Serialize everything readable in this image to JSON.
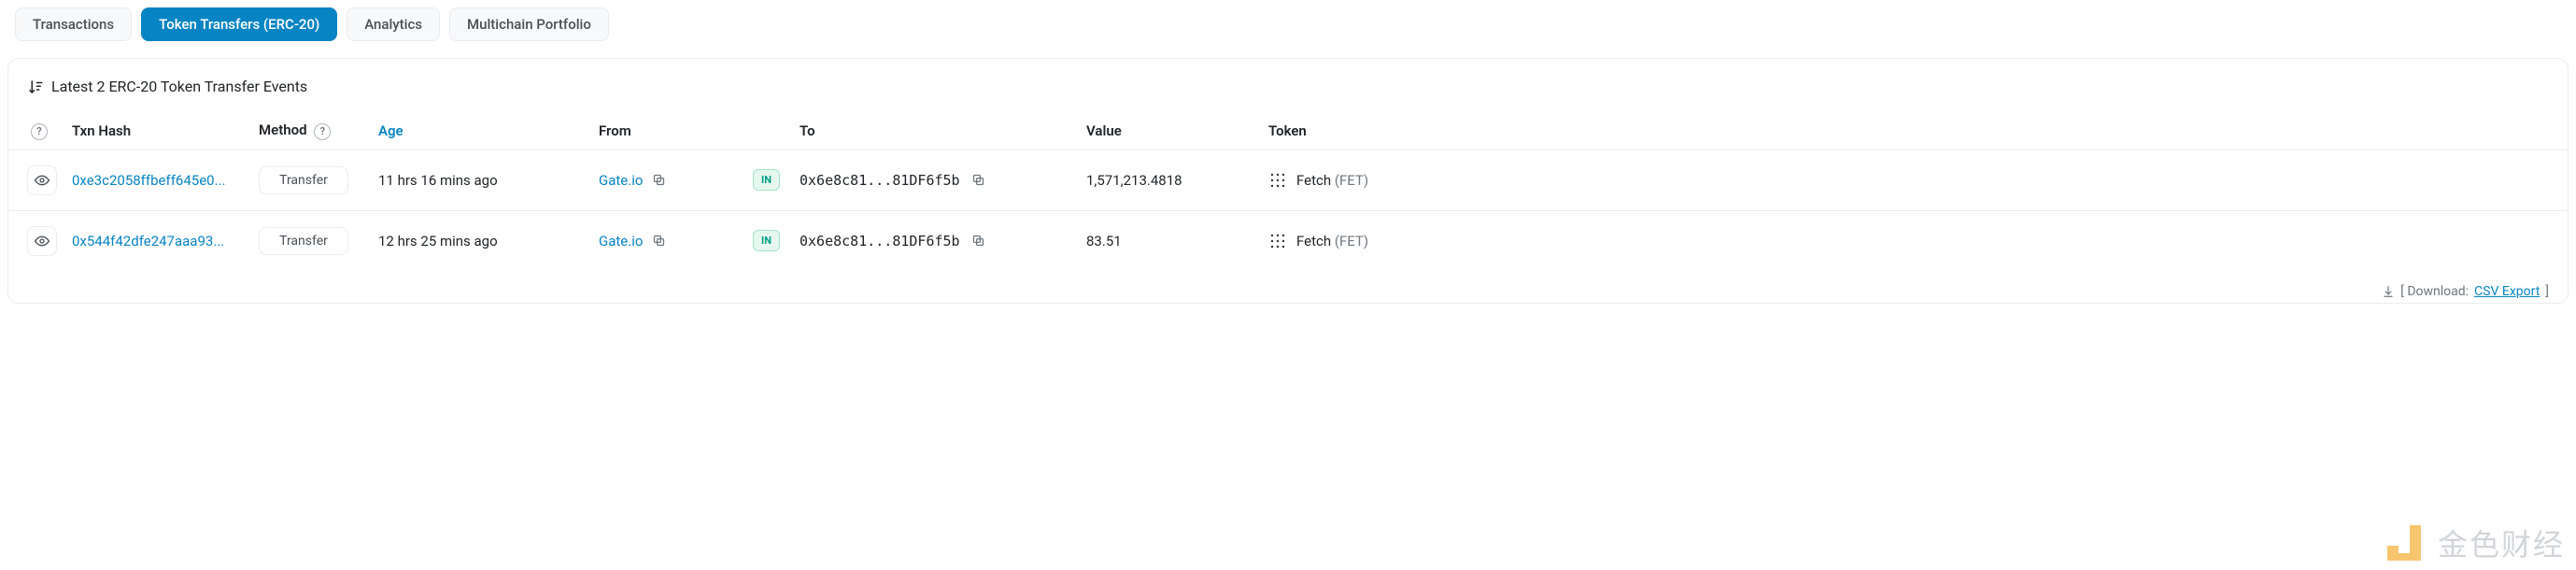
{
  "tabs": [
    {
      "label": "Transactions",
      "active": false
    },
    {
      "label": "Token Transfers (ERC-20)",
      "active": true
    },
    {
      "label": "Analytics",
      "active": false
    },
    {
      "label": "Multichain Portfolio",
      "active": false
    }
  ],
  "panel_title": "Latest 2 ERC-20 Token Transfer Events",
  "headers": {
    "hash": "Txn Hash",
    "method": "Method",
    "age": "Age",
    "from": "From",
    "to": "To",
    "value": "Value",
    "token": "Token"
  },
  "rows": [
    {
      "hash": "0xe3c2058ffbeff645e0...",
      "method": "Transfer",
      "age": "11 hrs 16 mins ago",
      "from": "Gate.io",
      "direction": "IN",
      "to": "0x6e8c81...81DF6f5b",
      "value": "1,571,213.4818",
      "token_name": "Fetch",
      "token_symbol": "(FET)"
    },
    {
      "hash": "0x544f42dfe247aaa93...",
      "method": "Transfer",
      "age": "12 hrs 25 mins ago",
      "from": "Gate.io",
      "direction": "IN",
      "to": "0x6e8c81...81DF6f5b",
      "value": "83.51",
      "token_name": "Fetch",
      "token_symbol": "(FET)"
    }
  ],
  "footer": {
    "prefix": "[ Download: ",
    "link": "CSV Export",
    "suffix": " ]"
  },
  "watermark_text": "金色财经"
}
